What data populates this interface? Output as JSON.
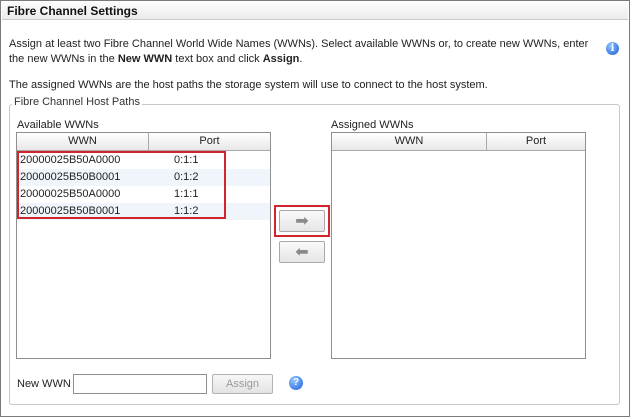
{
  "panel": {
    "title": "Fibre Channel Settings"
  },
  "intro": {
    "line1_a": "Assign at least two Fibre Channel World Wide Names (WWNs). Select available WWNs or, to create new WWNs, enter the new WWNs in the ",
    "line1_b": "New WWN",
    "line1_c": " text box and click ",
    "line1_d": "Assign",
    "line1_e": ".",
    "line2": "The assigned WWNs are the host paths the storage system will use to connect to the host system."
  },
  "group": {
    "legend": "Fibre Channel Host Paths"
  },
  "available": {
    "label": "Available WWNs",
    "col_wwn": "WWN",
    "col_port": "Port",
    "rows": [
      {
        "wwn": "20000025B50A0000",
        "port": "0:1:1"
      },
      {
        "wwn": "20000025B50B0001",
        "port": "0:1:2"
      },
      {
        "wwn": "20000025B50A0000",
        "port": "1:1:1"
      },
      {
        "wwn": "20000025B50B0001",
        "port": "1:1:2"
      }
    ]
  },
  "assigned": {
    "label": "Assigned WWNs",
    "col_wwn": "WWN",
    "col_port": "Port"
  },
  "buttons": {
    "add_icon": "arrow-right-icon",
    "remove_icon": "arrow-left-icon",
    "add_glyph": "➡",
    "remove_glyph": "⬅"
  },
  "new_wwn": {
    "label": "New WWN",
    "value": "",
    "assign_label": "Assign"
  },
  "icons": {
    "info": "i",
    "help": "?"
  },
  "colors": {
    "highlight": "#d0262b",
    "icon_blue": "#1d63d8"
  }
}
